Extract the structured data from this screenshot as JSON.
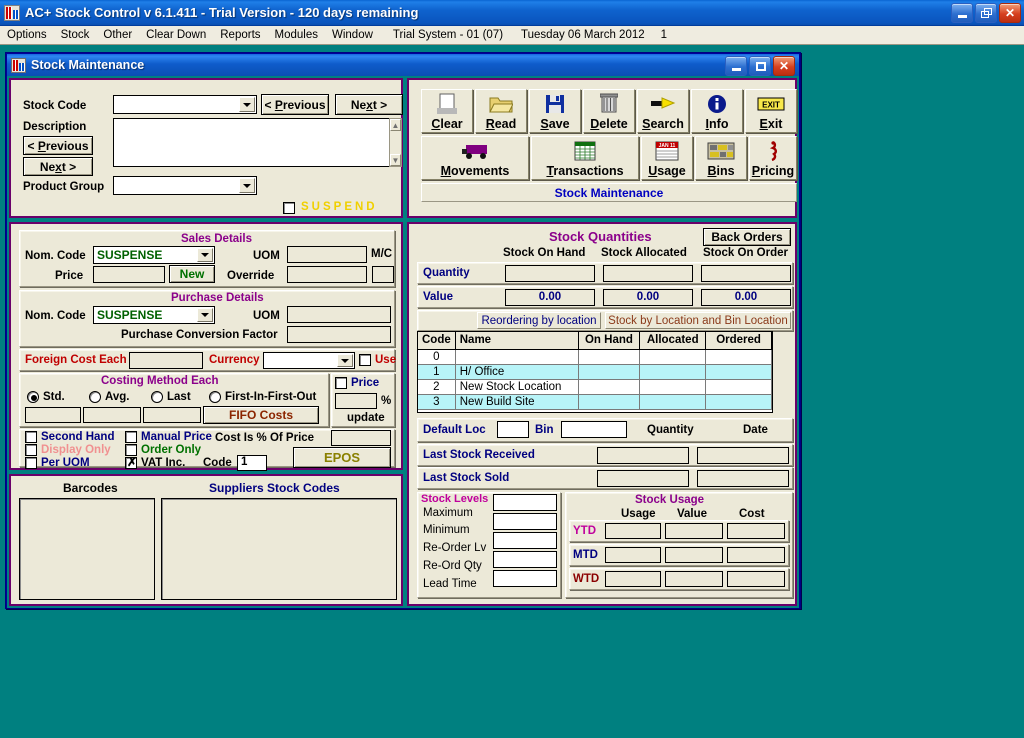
{
  "app": {
    "title": "AC+ Stock Control v 6.1.411 - Trial Version - 120 days remaining",
    "icon": "stock-control-app-icon",
    "window_buttons": {
      "minimize": "_",
      "restore": "❐",
      "close": "✕"
    }
  },
  "menubar": {
    "items": [
      "Options",
      "Stock",
      "Other",
      "Clear Down",
      "Reports",
      "Modules",
      "Window"
    ],
    "status_system": "Trial System - 01 (07)",
    "status_date": "Tuesday 06 March 2012",
    "status_user": "1"
  },
  "mdi": {
    "title": "Stock Maintenance",
    "icon": "stock-maintenance-icon",
    "window_buttons": {
      "minimize": "_",
      "maximize": "❐",
      "close": "✕"
    }
  },
  "header": {
    "stock_code_label": "Stock Code",
    "stock_code_value": "",
    "description_label": "Description",
    "description_value": "",
    "product_group_label": "Product Group",
    "product_group_value": "",
    "prev_button": "< Previous",
    "next_button": "Next >",
    "desc_prev_button": "< Previous",
    "desc_next_button": "Next >",
    "suspend_label": "SUSPEND",
    "suspend_checked": false
  },
  "toolbar": {
    "row1": [
      {
        "label": "Clear",
        "accel": "C",
        "icon": "document-blank-icon"
      },
      {
        "label": "Read",
        "accel": "R",
        "icon": "folder-open-icon"
      },
      {
        "label": "Save",
        "accel": "S",
        "icon": "floppy-disk-icon"
      },
      {
        "label": "Delete",
        "accel": "D",
        "icon": "trash-can-icon"
      },
      {
        "label": "Search",
        "accel": "S",
        "icon": "flashlight-icon"
      },
      {
        "label": "Info",
        "accel": "I",
        "icon": "info-circle-icon"
      },
      {
        "label": "Exit",
        "accel": "E",
        "icon": "exit-sign-icon"
      }
    ],
    "row2": [
      {
        "label": "Movements",
        "accel": "M",
        "icon": "truck-icon"
      },
      {
        "label": "Transactions",
        "accel": "T",
        "icon": "spreadsheet-icon"
      },
      {
        "label": "Usage",
        "accel": "U",
        "icon": "calendar-icon"
      },
      {
        "label": "Bins",
        "accel": "B",
        "icon": "bins-shelf-icon"
      },
      {
        "label": "Pricing",
        "accel": "P",
        "icon": "price-tag-icon"
      }
    ],
    "status_caption": "Stock Maintenance"
  },
  "sales_details": {
    "title": "Sales Details",
    "nom_code_label": "Nom. Code",
    "nom_code_value": "SUSPENSE",
    "uom_label": "UOM",
    "uom_value": "",
    "mc_label": "M/C",
    "mc_value": "",
    "price_label": "Price",
    "price_value": "",
    "new_button": "New",
    "override_label": "Override",
    "override_value": ""
  },
  "purchase_details": {
    "title": "Purchase Details",
    "nom_code_label": "Nom. Code",
    "nom_code_value": "SUSPENSE",
    "uom_label": "UOM",
    "uom_value": "",
    "conversion_label": "Purchase Conversion Factor",
    "conversion_value": ""
  },
  "foreign_cost": {
    "label": "Foreign Cost Each",
    "value": "",
    "currency_label": "Currency",
    "currency_value": "",
    "use_label": "Use",
    "use_checked": false
  },
  "costing": {
    "title": "Costing Method Each",
    "options": [
      {
        "label": "Std.",
        "selected": true,
        "value": ""
      },
      {
        "label": "Avg.",
        "selected": false,
        "value": ""
      },
      {
        "label": "Last",
        "selected": false,
        "value": ""
      },
      {
        "label": "First-In-First-Out",
        "selected": false,
        "value": ""
      }
    ],
    "fifo_button": "FIFO Costs",
    "price_check_label": "Price",
    "price_checked": false,
    "percent_value": "",
    "percent_symbol": "%",
    "update_label": "update"
  },
  "flags": {
    "second_hand": {
      "label": "Second Hand",
      "checked": false
    },
    "display_only": {
      "label": "Display Only",
      "checked": false
    },
    "per_uom": {
      "label": "Per UOM",
      "checked": false
    },
    "manual_price": {
      "label": "Manual Price",
      "checked": false
    },
    "order_only": {
      "label": "Order Only",
      "checked": false
    },
    "vat_inc": {
      "label": "VAT Inc.",
      "checked": true
    },
    "code_label": "Code",
    "code_value": "1",
    "cost_is_pct_label": "Cost Is % Of Price",
    "cost_is_pct_value": "",
    "epos_button": "EPOS"
  },
  "barcodes": {
    "title": "Barcodes",
    "items": []
  },
  "suppliers": {
    "title": "Suppliers Stock Codes",
    "items": []
  },
  "quantities": {
    "title": "Stock Quantities",
    "back_orders_button": "Back Orders",
    "columns": [
      "Stock On Hand",
      "Stock Allocated",
      "Stock On Order"
    ],
    "quantity_label": "Quantity",
    "quantity_values": [
      "",
      "",
      ""
    ],
    "value_label": "Value",
    "value_values": [
      "0.00",
      "0.00",
      "0.00"
    ]
  },
  "location_tabs": {
    "reordering": "Reordering by location",
    "stock_by_location": "Stock by Location and Bin Location"
  },
  "location_grid": {
    "columns": [
      "Code",
      "Name",
      "On Hand",
      "Allocated",
      "Ordered"
    ],
    "rows": [
      {
        "code": "0",
        "name": "",
        "on_hand": "",
        "allocated": "",
        "ordered": ""
      },
      {
        "code": "1",
        "name": "H/ Office",
        "on_hand": "",
        "allocated": "",
        "ordered": ""
      },
      {
        "code": "2",
        "name": "New Stock Location",
        "on_hand": "",
        "allocated": "",
        "ordered": ""
      },
      {
        "code": "3",
        "name": "New Build Site",
        "on_hand": "",
        "allocated": "",
        "ordered": ""
      }
    ]
  },
  "default_loc": {
    "loc_label": "Default Loc",
    "loc_value": "",
    "bin_label": "Bin",
    "bin_value": "",
    "quantity_header": "Quantity",
    "date_header": "Date",
    "last_received_label": "Last Stock Received",
    "last_received_qty": "",
    "last_received_date": "",
    "last_sold_label": "Last Stock Sold",
    "last_sold_qty": "",
    "last_sold_date": ""
  },
  "stock_levels": {
    "title": "Stock Levels",
    "rows": [
      {
        "label": "Maximum",
        "value": ""
      },
      {
        "label": "Minimum",
        "value": ""
      },
      {
        "label": "Re-Order Lv",
        "value": ""
      },
      {
        "label": "Re-Ord Qty",
        "value": ""
      },
      {
        "label": "Lead Time",
        "value": ""
      }
    ]
  },
  "stock_usage": {
    "title": "Stock Usage",
    "columns": [
      "Usage",
      "Value",
      "Cost"
    ],
    "rows": [
      {
        "period": "YTD",
        "usage": "",
        "value": "",
        "cost": ""
      },
      {
        "period": "MTD",
        "usage": "",
        "value": "",
        "cost": ""
      },
      {
        "period": "WTD",
        "usage": "",
        "value": "",
        "cost": ""
      }
    ]
  },
  "colors": {
    "desktop": "#008080",
    "panel_face": "#ECE9D8",
    "panel_border": "#6A006A",
    "title_blue": "#0F5CCB",
    "label_navy": "#000080",
    "accent_purple": "#8B008B",
    "grid_alt_row": "#B8F4F8"
  }
}
